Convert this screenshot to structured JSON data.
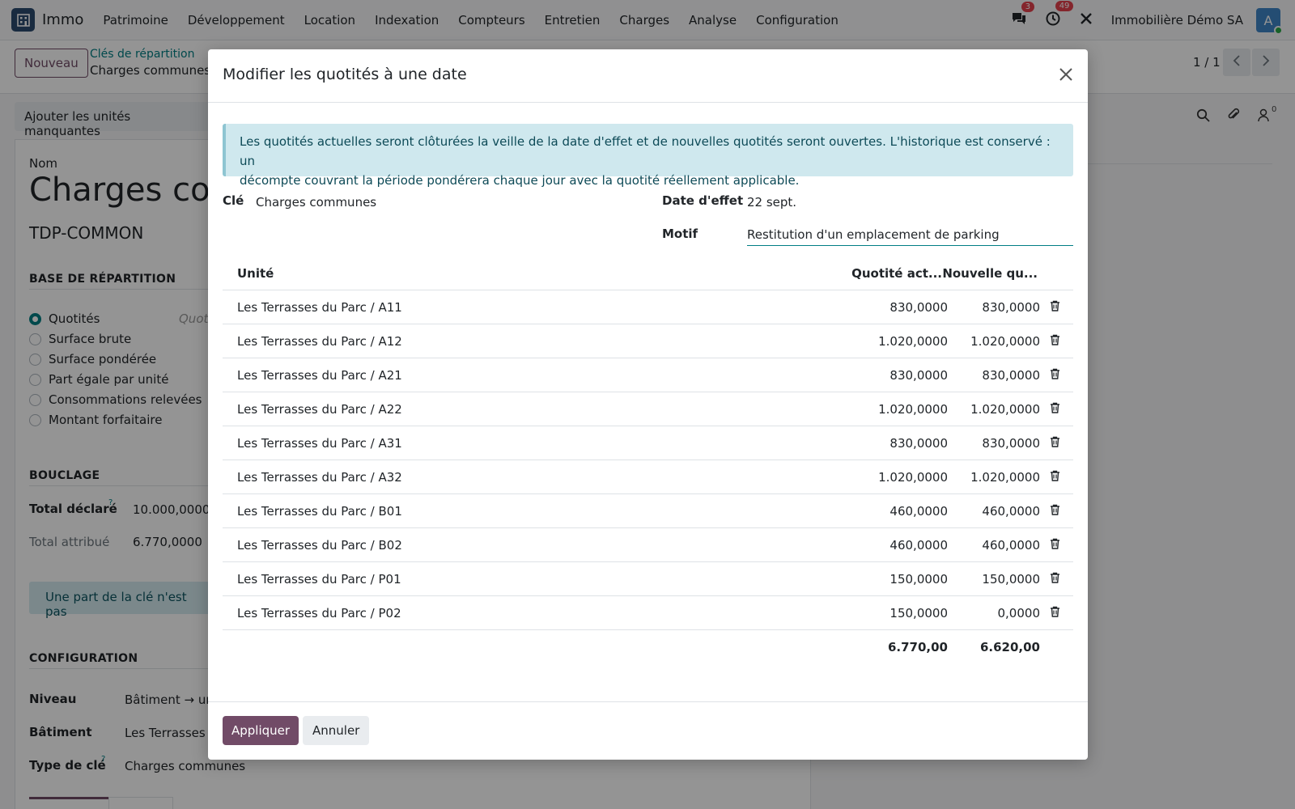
{
  "navbar": {
    "app_name": "Immo",
    "menu": [
      "Patrimoine",
      "Développement",
      "Location",
      "Indexation",
      "Compteurs",
      "Entretien",
      "Charges",
      "Analyse",
      "Configuration"
    ],
    "messages_badge": "3",
    "activities_badge": "49",
    "company": "Immobilière Démo SA",
    "avatar_letter": "A",
    "icons": [
      "app-building-icon",
      "chat-icon",
      "clock-icon",
      "tools-icon"
    ]
  },
  "control_panel": {
    "new_button": "Nouveau",
    "breadcrumb_parent": "Clés de répartition",
    "breadcrumb_current": "Charges communes",
    "pager": "1 / 1"
  },
  "background_form": {
    "action_button": "Ajouter les unités manquantes",
    "name_label": "Nom",
    "name_value": "Charges comm",
    "code": "TDP-COMMON",
    "section_base": "BASE DE RÉPARTITION",
    "base_options": [
      {
        "label": "Quotités",
        "selected": true
      },
      {
        "label": "Surface brute",
        "selected": false
      },
      {
        "label": "Surface pondérée",
        "selected": false
      },
      {
        "label": "Part égale par unité",
        "selected": false
      },
      {
        "label": "Consommations relevées",
        "selected": false
      },
      {
        "label": "Montant forfaitaire",
        "selected": false
      }
    ],
    "base_hint": "Quoti",
    "section_bouclage": "BOUCLAGE",
    "total_declared_label": "Total déclaré",
    "total_declared_value": "10.000,0000",
    "total_assigned_label": "Total attribué",
    "total_assigned_value": "6.770,0000",
    "alert_text": "Une part de la clé n'est pas",
    "section_config": "CONFIGURATION",
    "level_label": "Niveau",
    "level_value": "Bâtiment → un",
    "building_label": "Bâtiment",
    "building_value": "Les Terrasses",
    "key_type_label": "Type de clé",
    "key_type_value": "Charges communes",
    "chatter_follower_count": "0"
  },
  "modal": {
    "title": "Modifier les quotités à une date",
    "info_line1": "Les quotités actuelles seront clôturées la veille de la date d'effet et de nouvelles quotités seront ouvertes. L'historique est conservé : un",
    "info_line2": "décompte couvrant la période pondérera chaque jour avec la quotité réellement applicable.",
    "key_label": "Clé",
    "key_value": "Charges communes",
    "date_label": "Date d'effet",
    "date_value": "22 sept.",
    "motif_label": "Motif",
    "motif_value": "Restitution d'un emplacement de parking",
    "table": {
      "col_unit": "Unité",
      "col_current": "Quotité act...",
      "col_new": "Nouvelle qu...",
      "rows": [
        {
          "unit": "Les Terrasses du Parc / A11",
          "current": "830,0000",
          "new": "830,0000"
        },
        {
          "unit": "Les Terrasses du Parc / A12",
          "current": "1.020,0000",
          "new": "1.020,0000"
        },
        {
          "unit": "Les Terrasses du Parc / A21",
          "current": "830,0000",
          "new": "830,0000"
        },
        {
          "unit": "Les Terrasses du Parc / A22",
          "current": "1.020,0000",
          "new": "1.020,0000"
        },
        {
          "unit": "Les Terrasses du Parc / A31",
          "current": "830,0000",
          "new": "830,0000"
        },
        {
          "unit": "Les Terrasses du Parc / A32",
          "current": "1.020,0000",
          "new": "1.020,0000"
        },
        {
          "unit": "Les Terrasses du Parc / B01",
          "current": "460,0000",
          "new": "460,0000"
        },
        {
          "unit": "Les Terrasses du Parc / B02",
          "current": "460,0000",
          "new": "460,0000"
        },
        {
          "unit": "Les Terrasses du Parc / P01",
          "current": "150,0000",
          "new": "150,0000"
        },
        {
          "unit": "Les Terrasses du Parc / P02",
          "current": "150,0000",
          "new": "0,0000"
        }
      ],
      "total_current": "6.770,00",
      "total_new": "6.620,00"
    },
    "apply_button": "Appliquer",
    "cancel_button": "Annuler"
  },
  "colors": {
    "primary": "#714b67",
    "link": "#017e84",
    "info_bg": "#cfe8ee",
    "badge": "#e4414c",
    "avatar": "#3f86c6"
  }
}
